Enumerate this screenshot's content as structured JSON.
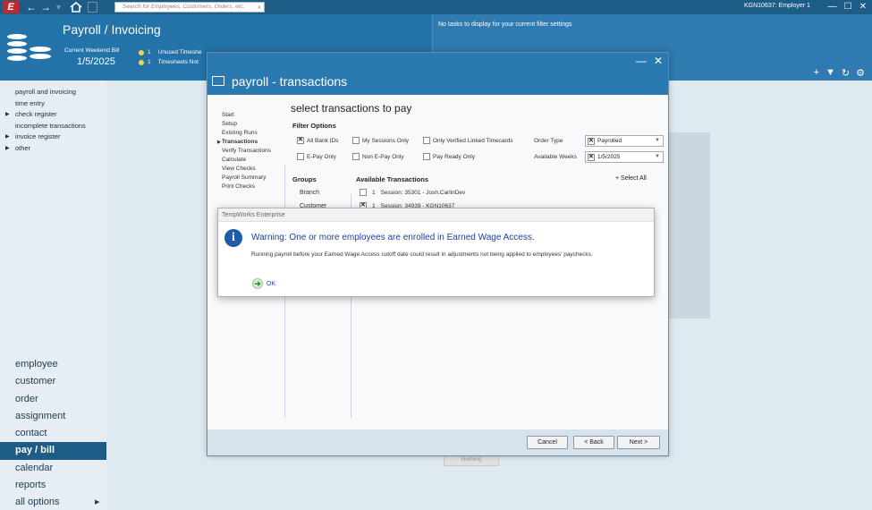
{
  "topbar": {
    "logo": "E",
    "search_placeholder": "Search for Employees, Customers, Orders, etc.",
    "employer_label": "KGN10637: Employer 1",
    "window_controls": [
      "—",
      "☐",
      "✕"
    ]
  },
  "header": {
    "title": "Payroll / Invoicing",
    "current_weekend_bill_label": "Current Weekend Bill",
    "current_weekend_bill_date": "1/5/2025",
    "status_items": [
      {
        "count": "1",
        "label": "Unused Timeshe"
      },
      {
        "count": "1",
        "label": "Timesheets Not"
      }
    ],
    "no_tasks_text": "No tasks to display for your current filter settings"
  },
  "sidebar": {
    "sub_items": [
      {
        "label": "payroll and invoicing",
        "arrow": false
      },
      {
        "label": "time entry",
        "arrow": false
      },
      {
        "label": "check register",
        "arrow": true
      },
      {
        "label": "incomplete transactions",
        "arrow": false
      },
      {
        "label": "invoice register",
        "arrow": true
      },
      {
        "label": "other",
        "arrow": true
      }
    ],
    "main_items": [
      {
        "label": "employee",
        "active": false
      },
      {
        "label": "customer",
        "active": false
      },
      {
        "label": "order",
        "active": false
      },
      {
        "label": "assignment",
        "active": false
      },
      {
        "label": "contact",
        "active": false
      },
      {
        "label": "pay / bill",
        "active": true
      },
      {
        "label": "calendar",
        "active": false
      },
      {
        "label": "reports",
        "active": false
      },
      {
        "label": "all options",
        "active": false
      }
    ]
  },
  "dialog": {
    "title": "payroll - transactions",
    "section_title": "select transactions to pay",
    "steps": [
      {
        "label": "Start",
        "current": false
      },
      {
        "label": "Setup",
        "current": false
      },
      {
        "label": "Existing Runs",
        "current": false
      },
      {
        "label": "Transactions",
        "current": true
      },
      {
        "label": "Verify Transactions",
        "current": false
      },
      {
        "label": "Calculate",
        "current": false
      },
      {
        "label": "View Checks",
        "current": false
      },
      {
        "label": "Payroll Summary",
        "current": false
      },
      {
        "label": "Print Checks",
        "current": false
      }
    ],
    "filter_title": "Filter Options",
    "filters": {
      "all_bank_ids": {
        "label": "All Bank IDs",
        "checked": true
      },
      "my_sessions_only": {
        "label": "My Sessions Only",
        "checked": false
      },
      "only_verified": {
        "label": "Only Verified Linked Timecards",
        "checked": false
      },
      "epay_only": {
        "label": "E-Pay Only",
        "checked": false
      },
      "non_epay_only": {
        "label": "Non E-Pay Only",
        "checked": false
      },
      "pay_ready_only": {
        "label": "Pay Ready Only",
        "checked": false
      }
    },
    "order_type_label": "Order Type",
    "order_type_value": "Payrolled",
    "available_weeks_label": "Available Weeks",
    "available_weeks_value": "1/5/2025",
    "groups_title": "Groups",
    "groups": [
      "Branch",
      "Customer"
    ],
    "available_title": "Available Transactions",
    "select_all": "Select All",
    "transactions": [
      {
        "count": "1",
        "label": "Session: 35301 - Josh.CarlinDev",
        "checked": false
      },
      {
        "count": "1",
        "label": "Session: 34939 - KGN10637",
        "checked": true
      }
    ],
    "buttons": {
      "cancel": "Cancel",
      "back": "< Back",
      "next": "Next >"
    }
  },
  "warning": {
    "window_title": "TempWorks Enterprise",
    "headline": "Warning: One or more employees are enrolled in Earned Wage Access.",
    "message": "Running payroll before your Earned Wage Access cutoff date could result in adjustments not being applied to employees' paychecks.",
    "ok_label": "OK"
  },
  "background": {
    "ghost_button": "Nothing"
  },
  "colors": {
    "topbar": "#1c5c86",
    "header": "#2372a8",
    "dialog_header": "#2a79b0",
    "active_nav": "#1c5c86",
    "warning_headline": "#1c3fa0"
  }
}
